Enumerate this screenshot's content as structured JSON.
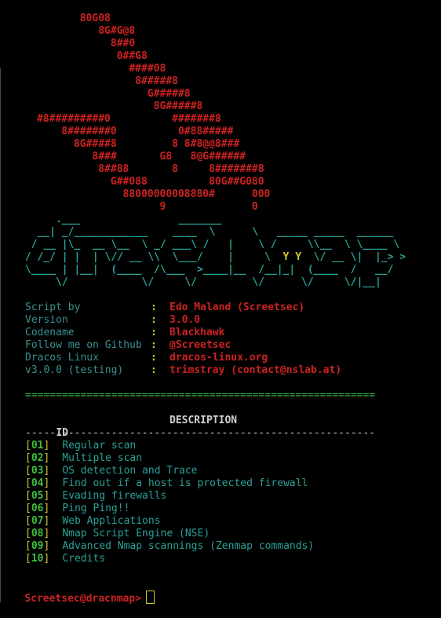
{
  "banner_art": {
    "text": "             80G08\n                8G#G@8\n                  8##0\n                   0##G8\n                     ####08\n                      8#####8\n                        G#####8\n                         8G#####8\n      #8#########0          #######8\n          8#######0          0#88#####\n            8G####8         8 8#8@@8###\n               8###       G8   8@G######\n                8##88       8     8#######8\n                  G##088          80G##G080\n                    88000000008880#      000\n                          9              0"
  },
  "logo_art": {
    "line1": "      .___                _______",
    "line2": "   __| _/____________    ____  \\      \\   _____ _____  ______",
    "line3": "  / __ |\\_  __ \\__  \\ _/ ___\\ /   |    \\ /     \\\\__  \\ \\____ \\",
    "line4a": " / /_/ | |  | \\// __ \\\\  \\___/    |     \\  ",
    "line4y": "Y Y",
    "line4b": "  \\/ __ \\|  |_> >",
    "line5": " \\____ | |__|  (____  /\\___  >____|__  /__|_|  (____  /   __/",
    "line6": "      \\/            \\/     \\/         \\/      \\/     \\/|__|"
  },
  "info": [
    {
      "key": "Script by",
      "colon": ":",
      "value": "Edo Maland (Screetsec)"
    },
    {
      "key": "Version",
      "colon": ":",
      "value": "3.0.0"
    },
    {
      "key": "Codename",
      "colon": ":",
      "value": "Blackhawk"
    },
    {
      "key": "Follow me on Github",
      "colon": ":",
      "value": "@Screetsec"
    },
    {
      "key": "Dracos Linux",
      "colon": ":",
      "value": "dracos-linux.org"
    },
    {
      "key": "v3.0.0 (testing)",
      "colon": ":",
      "value": "trimstray (contact@nslab.at)"
    }
  ],
  "separator": "=========================================================",
  "table_header": {
    "id": "ID",
    "description": "DESCRIPTION"
  },
  "dash_line": "---------------------------------------------------------",
  "menu": [
    {
      "id": "01",
      "label": "Regular scan"
    },
    {
      "id": "02",
      "label": "Multiple scan"
    },
    {
      "id": "03",
      "label": "OS detection and Trace"
    },
    {
      "id": "04",
      "label": "Find out if a host is protected firewall"
    },
    {
      "id": "05",
      "label": "Evading firewalls"
    },
    {
      "id": "06",
      "label": "Ping Ping!!"
    },
    {
      "id": "07",
      "label": "Web Applications"
    },
    {
      "id": "08",
      "label": "Nmap Script Engine (NSE)"
    },
    {
      "id": "09",
      "label": "Advanced Nmap scannings (Zenmap commands)"
    },
    {
      "id": "10",
      "label": "Credits"
    }
  ],
  "prompt": {
    "text": "Screetsec@dracnmap>",
    "input": ""
  },
  "colors": {
    "background": "#000000",
    "red": "#cc2222",
    "teal": "#2aa198",
    "yellow": "#d4c830",
    "green": "#3fbf3f"
  }
}
